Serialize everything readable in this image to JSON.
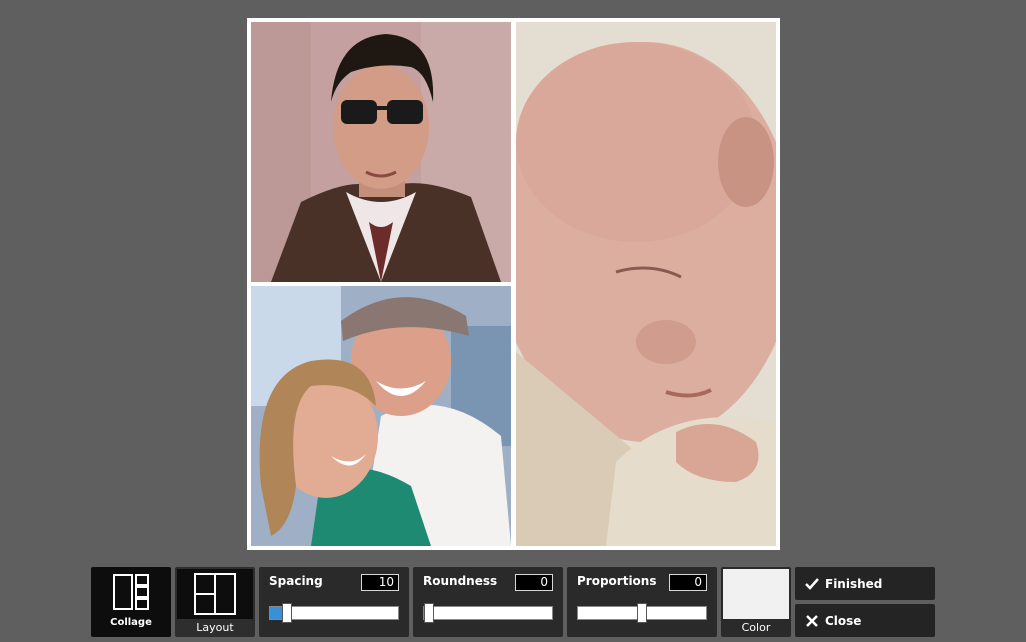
{
  "collage": {
    "photos": [
      {
        "name": "man-with-sunglasses"
      },
      {
        "name": "smiling-couple"
      },
      {
        "name": "sleeping-baby"
      }
    ],
    "background_color": "#ffffff"
  },
  "toolbar": {
    "collage_label": "Collage",
    "layout_label": "Layout",
    "spacing": {
      "label": "Spacing",
      "value": "10",
      "fraction": 0.1
    },
    "roundness": {
      "label": "Roundness",
      "value": "0",
      "fraction": 0.0
    },
    "proportions": {
      "label": "Proportions",
      "value": "0",
      "fraction": 0.5
    },
    "color_label": "Color",
    "color_value": "#f1f1f1",
    "finished_label": "Finished",
    "close_label": "Close",
    "accent_color": "#3a8fd9"
  }
}
